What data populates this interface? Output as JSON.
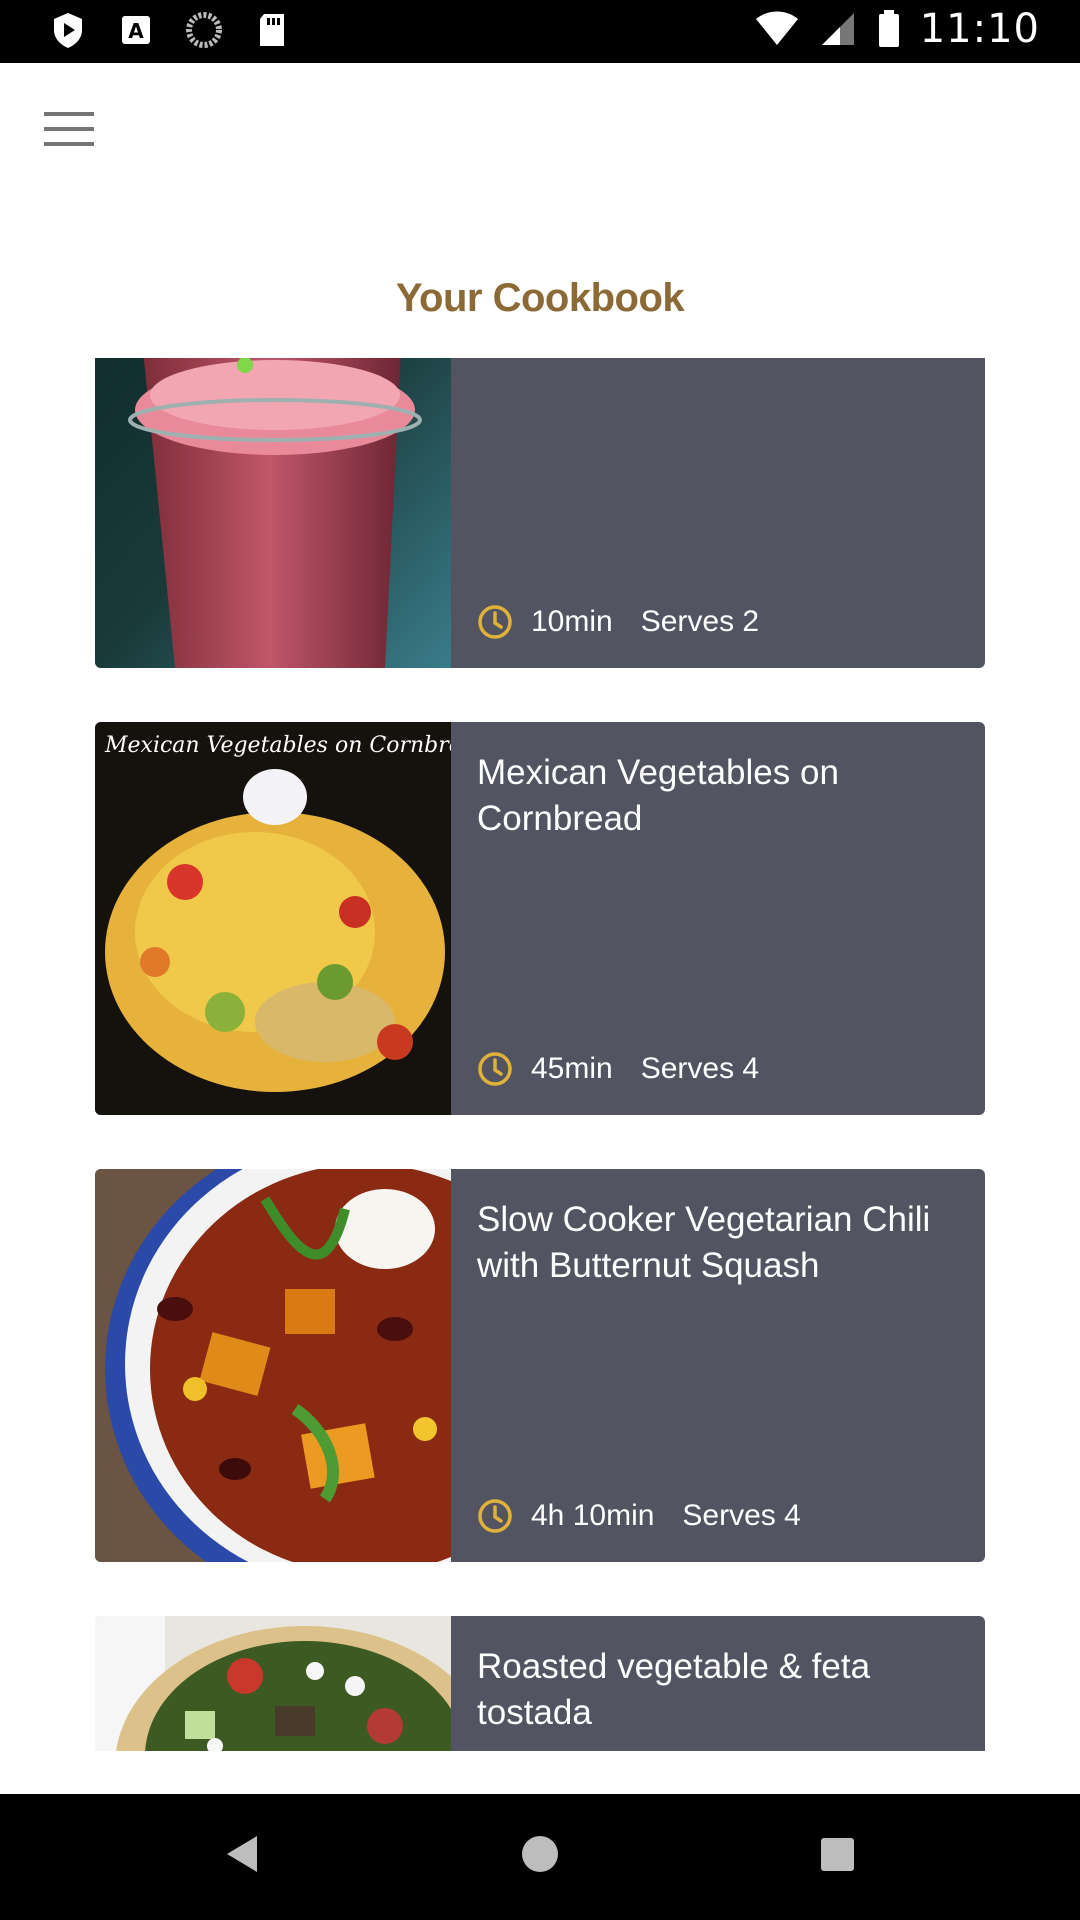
{
  "status_bar": {
    "time": "11:10",
    "icons": [
      "play-protect-icon",
      "accessibility-icon",
      "sync-icon",
      "sd-card-icon",
      "wifi-icon",
      "signal-icon",
      "battery-icon"
    ]
  },
  "header": {
    "title": "Your Cookbook",
    "menu_icon": "hamburger-menu-icon"
  },
  "recipes": [
    {
      "title": "",
      "time": "10min",
      "serves": "Serves 2"
    },
    {
      "title": "Mexican Vegetables on Cornbread",
      "time": "45min",
      "serves": "Serves 4",
      "image_caption": "Mexican Vegetables on Cornbread"
    },
    {
      "title": "Slow Cooker Vegetarian Chili with Butternut Squash",
      "time": "4h 10min",
      "serves": "Serves 4"
    },
    {
      "title": "Roasted vegetable & feta tostada",
      "time": "",
      "serves": ""
    }
  ],
  "nav_bar": {
    "back_icon": "back-triangle-icon",
    "home_icon": "home-circle-icon",
    "recents_icon": "recents-square-icon"
  },
  "colors": {
    "title": "#8b6a35",
    "card_bg": "#525461",
    "clock": "#e0b23a"
  }
}
